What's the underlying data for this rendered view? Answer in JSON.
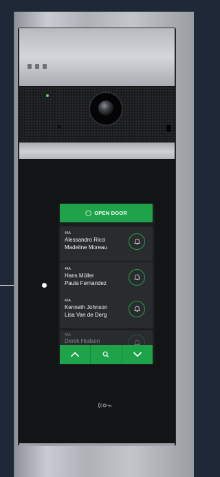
{
  "panel": {
    "open_door_label": "OPEN DOOR",
    "residents": [
      {
        "apartment": "45A",
        "names": [
          "Alessandro Ricci",
          "Madeline Moreau"
        ]
      },
      {
        "apartment": "44A",
        "names": [
          "Hans Müller",
          "Paula Fernandez"
        ]
      },
      {
        "apartment": "43A",
        "names": [
          "Kenneth Johnson",
          "Lisa Van de Derg"
        ]
      },
      {
        "apartment": "42A",
        "names": [
          "Derek Hudson"
        ]
      }
    ],
    "nav": {
      "up_icon": "chevron-up-icon",
      "search_icon": "search-icon",
      "down_icon": "chevron-down-icon"
    },
    "nfc_icon": "nfc-key-icon",
    "colors": {
      "accent": "#1ea34a",
      "background": "#1f2836",
      "screen": "#1c1d1f"
    }
  }
}
